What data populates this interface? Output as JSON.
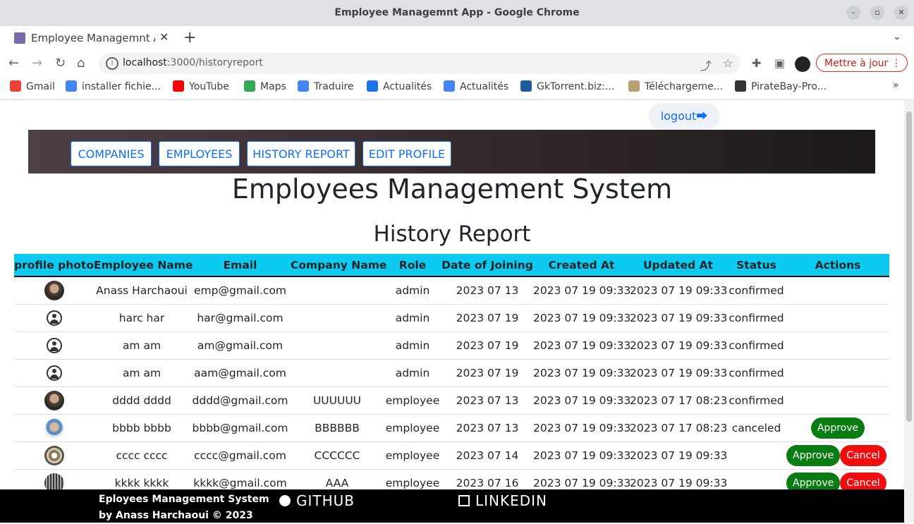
{
  "window": {
    "title": "Employee Managemnt App - Google Chrome"
  },
  "tab": {
    "title": "Employee Managemnt App"
  },
  "address": {
    "host": "localhost",
    "path": ":3000/historyreport"
  },
  "update_button": "Mettre à jour",
  "bookmarks": [
    "Gmail",
    "installer fichie...",
    "YouTube",
    "Maps",
    "Traduire",
    "Actualités",
    "Actualités",
    "GkTorrent.biz:...",
    "Téléchargeme...",
    "PirateBay-Pro..."
  ],
  "logout": "logout",
  "nav": [
    "COMPANIES",
    "EMPLOYEES",
    "HISTORY REPORT",
    "EDIT PROFILE"
  ],
  "heading": "Employees Management System",
  "subheading": "History Report",
  "table": {
    "headers": [
      "profile photo",
      "Employee Name",
      "Email",
      "Company Name",
      "Role",
      "Date of Joining",
      "Created At",
      "Updated At",
      "Status",
      "Actions"
    ],
    "rows": [
      {
        "photo": "photo-a",
        "name": "Anass Harchaoui",
        "email": "emp@gmail.com",
        "company": "",
        "role": "admin",
        "joined": "2023 07 13",
        "created": "2023 07 19 09:33",
        "updated": "2023 07 19 09:33",
        "status": "confirmed",
        "actions": []
      },
      {
        "photo": "default",
        "name": "harc har",
        "email": "har@gmail.com",
        "company": "",
        "role": "admin",
        "joined": "2023 07 19",
        "created": "2023 07 19 09:33",
        "updated": "2023 07 19 09:33",
        "status": "confirmed",
        "actions": []
      },
      {
        "photo": "default",
        "name": "am am",
        "email": "am@gmail.com",
        "company": "",
        "role": "admin",
        "joined": "2023 07 19",
        "created": "2023 07 19 09:33",
        "updated": "2023 07 19 09:33",
        "status": "confirmed",
        "actions": []
      },
      {
        "photo": "default",
        "name": "am am",
        "email": "aam@gmail.com",
        "company": "",
        "role": "admin",
        "joined": "2023 07 19",
        "created": "2023 07 19 09:33",
        "updated": "2023 07 19 09:33",
        "status": "confirmed",
        "actions": []
      },
      {
        "photo": "photo-a",
        "name": "dddd dddd",
        "email": "dddd@gmail.com",
        "company": "UUUUUU",
        "role": "employee",
        "joined": "2023 07 13",
        "created": "2023 07 19 09:33",
        "updated": "2023 07 17 08:23",
        "status": "confirmed",
        "actions": []
      },
      {
        "photo": "photo-b",
        "name": "bbbb bbbb",
        "email": "bbbb@gmail.com",
        "company": "BBBBBB",
        "role": "employee",
        "joined": "2023 07 13",
        "created": "2023 07 19 09:33",
        "updated": "2023 07 17 08:23",
        "status": "canceled",
        "actions": [
          "Approve"
        ]
      },
      {
        "photo": "photo-c",
        "name": "cccc cccc",
        "email": "cccc@gmail.com",
        "company": "CCCCCC",
        "role": "employee",
        "joined": "2023 07 14",
        "created": "2023 07 19 09:33",
        "updated": "2023 07 19 09:33",
        "status": "",
        "actions": [
          "Approve",
          "Cancel"
        ]
      },
      {
        "photo": "photo-d",
        "name": "kkkk kkkk",
        "email": "kkkk@gmail.com",
        "company": "AAA",
        "role": "employee",
        "joined": "2023 07 16",
        "created": "2023 07 19 09:33",
        "updated": "2023 07 19 09:33",
        "status": "",
        "actions": [
          "Approve",
          "Cancel"
        ]
      }
    ]
  },
  "footer": {
    "line1": "Eployees Management System",
    "line2": "by Anass Harchaoui © 2023",
    "github": "GITHUB",
    "linkedin": "LINKEDIN"
  },
  "colors": {
    "accent": "#0d6efd",
    "header_bg": "#0dcaf0",
    "approve": "#0a7d12",
    "cancel": "#f00d0d",
    "footer_bg": "#000000"
  }
}
